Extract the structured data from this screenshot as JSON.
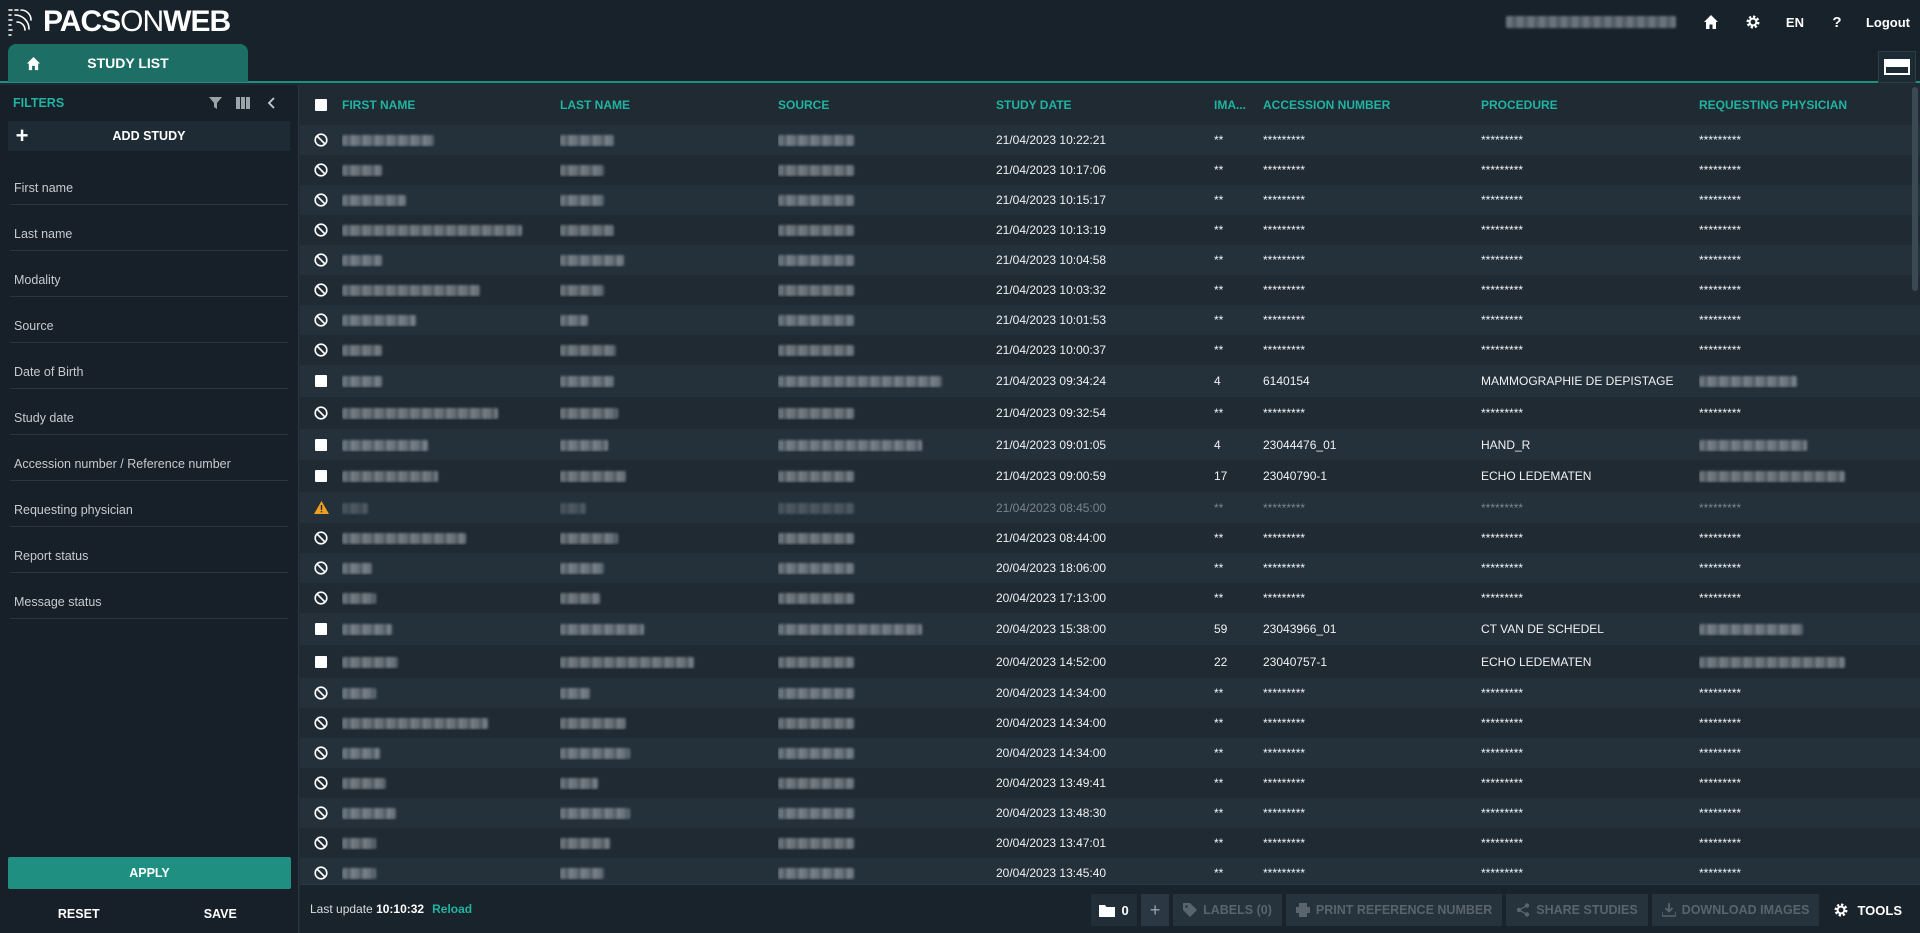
{
  "header": {
    "logo_text_a": "PACS",
    "logo_text_b": "ON",
    "logo_text_c": "WEB",
    "lang": "EN",
    "help": "?",
    "logout": "Logout"
  },
  "tabs": {
    "study_list": "STUDY LIST"
  },
  "sidebar": {
    "title": "FILTERS",
    "add_study": "ADD STUDY",
    "filters": [
      "First name",
      "Last name",
      "Modality",
      "Source",
      "Date of Birth",
      "Study date",
      "Accession number / Reference number",
      "Requesting physician",
      "Report status",
      "Message status"
    ],
    "apply": "APPLY",
    "reset": "RESET",
    "save": "SAVE"
  },
  "table": {
    "columns": [
      "FIRST NAME",
      "LAST NAME",
      "SOURCE",
      "STUDY DATE",
      "IMA...",
      "ACCESSION NUMBER",
      "PROCEDURE",
      "REQUESTING PHYSICIAN"
    ],
    "rows": [
      {
        "state": "blocked",
        "date": "21/04/2023 10:22:21",
        "ima": "**",
        "acc": "*********",
        "proc": "*********",
        "phys": "*********",
        "fn": 92,
        "ln": 54,
        "src": 76,
        "physw": 0
      },
      {
        "state": "blocked",
        "date": "21/04/2023 10:17:06",
        "ima": "**",
        "acc": "*********",
        "proc": "*********",
        "phys": "*********",
        "fn": 40,
        "ln": 44,
        "src": 76,
        "physw": 0
      },
      {
        "state": "blocked",
        "date": "21/04/2023 10:15:17",
        "ima": "**",
        "acc": "*********",
        "proc": "*********",
        "phys": "*********",
        "fn": 64,
        "ln": 44,
        "src": 76,
        "physw": 0
      },
      {
        "state": "blocked",
        "date": "21/04/2023 10:13:19",
        "ima": "**",
        "acc": "*********",
        "proc": "*********",
        "phys": "*********",
        "fn": 180,
        "ln": 54,
        "src": 76,
        "physw": 0
      },
      {
        "state": "blocked",
        "date": "21/04/2023 10:04:58",
        "ima": "**",
        "acc": "*********",
        "proc": "*********",
        "phys": "*********",
        "fn": 40,
        "ln": 64,
        "src": 76,
        "physw": 0
      },
      {
        "state": "blocked",
        "date": "21/04/2023 10:03:32",
        "ima": "**",
        "acc": "*********",
        "proc": "*********",
        "phys": "*********",
        "fn": 138,
        "ln": 44,
        "src": 76,
        "physw": 0
      },
      {
        "state": "blocked",
        "date": "21/04/2023 10:01:53",
        "ima": "**",
        "acc": "*********",
        "proc": "*********",
        "phys": "*********",
        "fn": 74,
        "ln": 28,
        "src": 76,
        "physw": 0
      },
      {
        "state": "blocked",
        "date": "21/04/2023 10:00:37",
        "ima": "**",
        "acc": "*********",
        "proc": "*********",
        "phys": "*********",
        "fn": 40,
        "ln": 56,
        "src": 76,
        "physw": 0
      },
      {
        "state": "check",
        "date": "21/04/2023 09:34:24",
        "ima": "4",
        "acc": "6140154",
        "proc": "MAMMOGRAPHIE DE DEPISTAGE",
        "phys": "",
        "fn": 40,
        "ln": 54,
        "src": 164,
        "physw": 98
      },
      {
        "state": "blocked",
        "date": "21/04/2023 09:32:54",
        "ima": "**",
        "acc": "*********",
        "proc": "*********",
        "phys": "*********",
        "fn": 156,
        "ln": 58,
        "src": 76,
        "physw": 0
      },
      {
        "state": "check",
        "date": "21/04/2023 09:01:05",
        "ima": "4",
        "acc": "23044476_01",
        "proc": "HAND_R",
        "phys": "",
        "fn": 86,
        "ln": 48,
        "src": 144,
        "physw": 108
      },
      {
        "state": "check",
        "date": "21/04/2023 09:00:59",
        "ima": "17",
        "acc": "23040790-1",
        "proc": "ECHO LEDEMATEN",
        "phys": "",
        "fn": 96,
        "ln": 66,
        "src": 76,
        "physw": 146
      },
      {
        "state": "warn",
        "date": "21/04/2023 08:45:00",
        "ima": "**",
        "acc": "*********",
        "proc": "*********",
        "phys": "*********",
        "fn": 26,
        "ln": 26,
        "src": 76,
        "physw": 0
      },
      {
        "state": "blocked",
        "date": "21/04/2023 08:44:00",
        "ima": "**",
        "acc": "*********",
        "proc": "*********",
        "phys": "*********",
        "fn": 124,
        "ln": 58,
        "src": 76,
        "physw": 0
      },
      {
        "state": "blocked",
        "date": "20/04/2023 18:06:00",
        "ima": "**",
        "acc": "*********",
        "proc": "*********",
        "phys": "*********",
        "fn": 30,
        "ln": 44,
        "src": 76,
        "physw": 0
      },
      {
        "state": "blocked",
        "date": "20/04/2023 17:13:00",
        "ima": "**",
        "acc": "*********",
        "proc": "*********",
        "phys": "*********",
        "fn": 34,
        "ln": 40,
        "src": 76,
        "physw": 0
      },
      {
        "state": "check",
        "date": "20/04/2023 15:38:00",
        "ima": "59",
        "acc": "23043966_01",
        "proc": "CT VAN DE SCHEDEL",
        "phys": "",
        "fn": 50,
        "ln": 84,
        "src": 144,
        "physw": 104
      },
      {
        "state": "check",
        "date": "20/04/2023 14:52:00",
        "ima": "22",
        "acc": "23040757-1",
        "proc": "ECHO LEDEMATEN",
        "phys": "",
        "fn": 56,
        "ln": 134,
        "src": 76,
        "physw": 146
      },
      {
        "state": "blocked",
        "date": "20/04/2023 14:34:00",
        "ima": "**",
        "acc": "*********",
        "proc": "*********",
        "phys": "*********",
        "fn": 34,
        "ln": 30,
        "src": 76,
        "physw": 0
      },
      {
        "state": "blocked",
        "date": "20/04/2023 14:34:00",
        "ima": "**",
        "acc": "*********",
        "proc": "*********",
        "phys": "*********",
        "fn": 146,
        "ln": 66,
        "src": 76,
        "physw": 0
      },
      {
        "state": "blocked",
        "date": "20/04/2023 14:34:00",
        "ima": "**",
        "acc": "*********",
        "proc": "*********",
        "phys": "*********",
        "fn": 38,
        "ln": 70,
        "src": 76,
        "physw": 0
      },
      {
        "state": "blocked",
        "date": "20/04/2023 13:49:41",
        "ima": "**",
        "acc": "*********",
        "proc": "*********",
        "phys": "*********",
        "fn": 44,
        "ln": 38,
        "src": 76,
        "physw": 0
      },
      {
        "state": "blocked",
        "date": "20/04/2023 13:48:30",
        "ima": "**",
        "acc": "*********",
        "proc": "*********",
        "phys": "*********",
        "fn": 54,
        "ln": 70,
        "src": 76,
        "physw": 0
      },
      {
        "state": "blocked",
        "date": "20/04/2023 13:47:01",
        "ima": "**",
        "acc": "*********",
        "proc": "*********",
        "phys": "*********",
        "fn": 34,
        "ln": 50,
        "src": 76,
        "physw": 0
      },
      {
        "state": "blocked",
        "date": "20/04/2023 13:45:40",
        "ima": "**",
        "acc": "*********",
        "proc": "*********",
        "phys": "*********",
        "fn": 34,
        "ln": 44,
        "src": 76,
        "physw": 0
      }
    ]
  },
  "footer": {
    "last_update_label": "Last update",
    "last_update_time": "10:10:32",
    "reload": "Reload",
    "folder_count": "0",
    "labels": "LABELS (0)",
    "print_ref": "PRINT REFERENCE NUMBER",
    "share": "SHARE STUDIES",
    "download": "DOWNLOAD IMAGES",
    "tools": "TOOLS"
  },
  "colors": {
    "accent": "#21b3a1",
    "tab": "#1d6f66",
    "warning": "#f0a020"
  }
}
